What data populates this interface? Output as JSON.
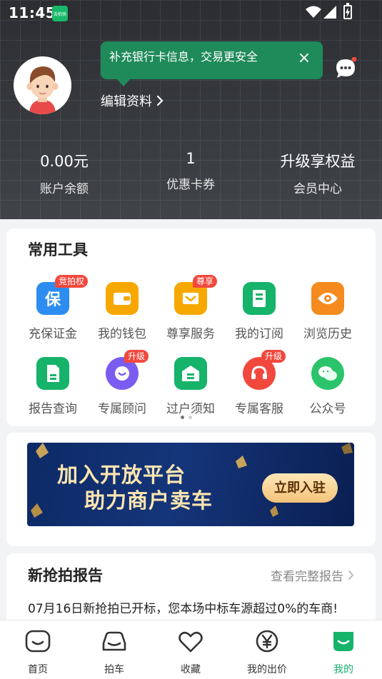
{
  "status_bar": {
    "time": "11:45",
    "app_badge": "去拍快"
  },
  "header": {
    "tooltip": "补充银行卡信息，交易更安全",
    "edit_profile": "编辑资料",
    "stats": [
      {
        "value": "0.00元",
        "label": "账户余额"
      },
      {
        "value": "1",
        "label": "优惠卡券"
      },
      {
        "value": "升级享权益",
        "label": "会员中心"
      }
    ]
  },
  "tools": {
    "title": "常用工具",
    "items": [
      {
        "label": "充保证金",
        "badge": "竞拍权",
        "icon": "shield-icon",
        "color": "#2d8cf0"
      },
      {
        "label": "我的钱包",
        "badge": "",
        "icon": "wallet-icon",
        "color": "#f7a800"
      },
      {
        "label": "尊享服务",
        "badge": "尊享",
        "icon": "crown-icon",
        "color": "#f7a800"
      },
      {
        "label": "我的订阅",
        "badge": "",
        "icon": "bookmark-icon",
        "color": "#16b36b"
      },
      {
        "label": "浏览历史",
        "badge": "",
        "icon": "eye-icon",
        "color": "#f58a1f"
      },
      {
        "label": "报告查询",
        "badge": "",
        "icon": "report-icon",
        "color": "#16b36b"
      },
      {
        "label": "专属顾问",
        "badge": "升级",
        "icon": "advisor-icon",
        "color": "#7b5cf0"
      },
      {
        "label": "过户须知",
        "badge": "",
        "icon": "transfer-icon",
        "color": "#16b36b"
      },
      {
        "label": "专属客服",
        "badge": "升级",
        "icon": "service-icon",
        "color": "#f1483d"
      },
      {
        "label": "公众号",
        "badge": "",
        "icon": "wechat-icon",
        "color": "#2bc46b"
      }
    ]
  },
  "banner": {
    "line1": "加入开放平台",
    "line2": "助力商户卖车",
    "cta": "立即入驻"
  },
  "report": {
    "title": "新抢拍报告",
    "link": "查看完整报告",
    "text": "07月16日新抢拍已开标，您本场中标车源超过0%的车商!"
  },
  "nav": {
    "items": [
      {
        "label": "首页",
        "icon": "home-icon"
      },
      {
        "label": "拍车",
        "icon": "car-icon"
      },
      {
        "label": "收藏",
        "icon": "heart-icon"
      },
      {
        "label": "我的出价",
        "icon": "yuan-icon"
      },
      {
        "label": "我的",
        "icon": "profile-icon",
        "active": true
      }
    ]
  }
}
